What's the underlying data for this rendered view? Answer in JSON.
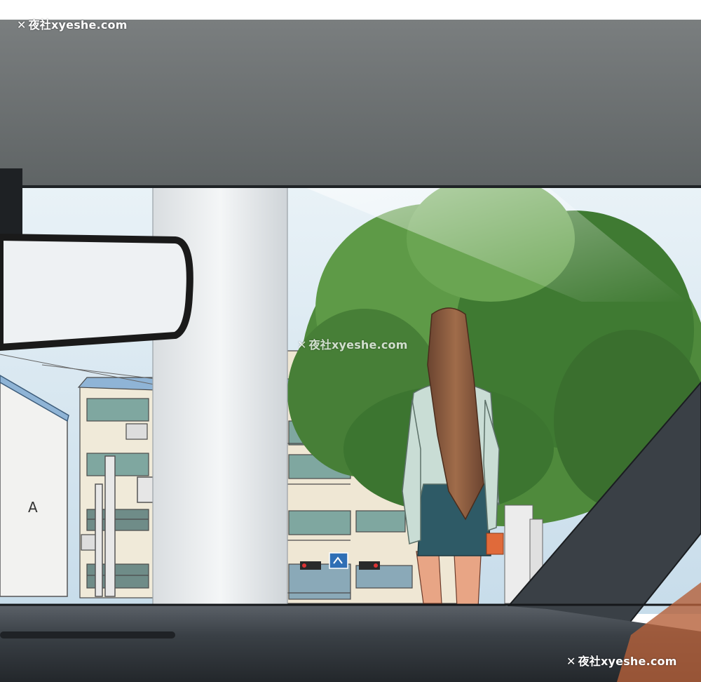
{
  "watermark": {
    "mark": "✕",
    "text": "夜社xyeshe.com"
  },
  "building_sign_letter": "A",
  "colors": {
    "headliner": "#6e7273",
    "sky": "#d8e9f3",
    "tree_green": "#4f8a3c",
    "dashboard": "#3a4046",
    "skirt": "#2e5a66",
    "shirt": "#c9ddd5",
    "hair": "#8a5a3c"
  },
  "icons": [
    "rearview-mirror",
    "traffic-sign"
  ]
}
